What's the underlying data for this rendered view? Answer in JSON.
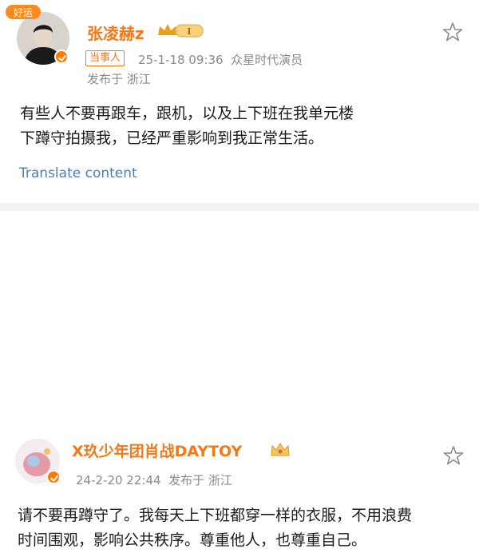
{
  "post1": {
    "corner_tag": "好运",
    "username": "张凌赫z",
    "vip_level": "I",
    "tag": "当事人",
    "timestamp": "25-1-18 09:36",
    "source": "众星时代演员",
    "location": "发布于 浙江",
    "content_lines": [
      "有些人不要再跟车，跟机，以及上下班在我单元楼",
      "下蹲守拍摄我，已经严重影响到我正常生活。"
    ],
    "translate_label": "Translate content"
  },
  "post2": {
    "username": "X玖少年团肖战DAYTOY",
    "timestamp": "24-2-20 22:44",
    "location": "发布于 浙江",
    "content_lines": [
      "请不要再蹲守了。我每天上下班都穿一样的衣服，不用浪费",
      "时间围观，影响公共秩序。尊重他人，也尊重自己。"
    ]
  },
  "colors": {
    "username": "#f07a19",
    "meta": "#8a8a8a",
    "translate": "#4a7fb5",
    "verified_badge": "#ff7a00"
  },
  "icons": [
    "star-icon",
    "vip-crown-icon",
    "verified-badge-icon",
    "fan-crown-icon"
  ]
}
